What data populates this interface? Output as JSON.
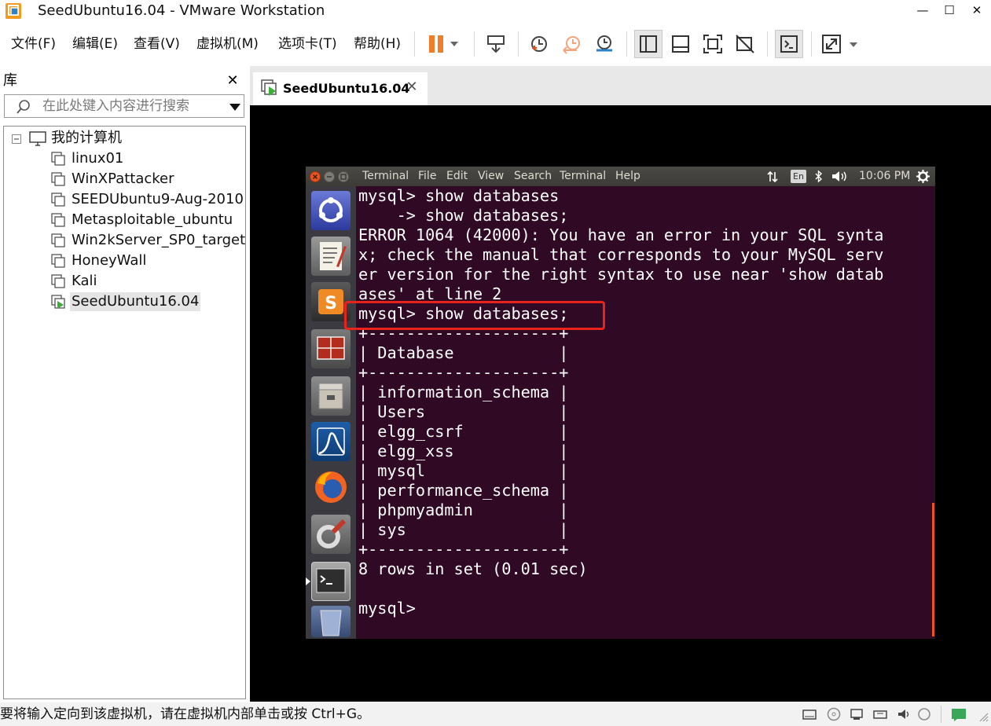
{
  "window": {
    "title": "SeedUbuntu16.04 - VMware Workstation"
  },
  "menu": [
    "文件(F)",
    "编辑(E)",
    "查看(V)",
    "虚拟机(M)",
    "选项卡(T)",
    "帮助(H)"
  ],
  "library": {
    "title": "库",
    "search_placeholder": "在此处键入内容进行搜索",
    "root": "我的计算机",
    "items": [
      "linux01",
      "WinXPattacker",
      "SEEDUbuntu9-Aug-2010",
      "Metasploitable_ubuntu",
      "Win2kServer_SP0_target",
      "HoneyWall",
      "Kali",
      "SeedUbuntu16.04"
    ],
    "selected_index": 7
  },
  "tab": {
    "label": "SeedUbuntu16.04"
  },
  "vm": {
    "menu": [
      "Terminal",
      "File",
      "Edit",
      "View",
      "Search",
      "Terminal",
      "Help"
    ],
    "clock": "10:06 PM",
    "keyboard": "En",
    "terminal_text": "mysql> show databases\n    -> show databases;\nERROR 1064 (42000): You have an error in your SQL synta\nx; check the manual that corresponds to your MySQL serv\ner version for the right syntax to use near 'show datab\nases' at line 2\nmysql> show databases;\n+--------------------+\n| Database           |\n+--------------------+\n| information_schema |\n| Users              |\n| elgg_csrf          |\n| elgg_xss           |\n| mysql              |\n| performance_schema |\n| phpmyadmin         |\n| sys                |\n+--------------------+\n8 rows in set (0.01 sec)\n\nmysql> "
  },
  "status": {
    "text": "要将输入定向到该虚拟机，请在虚拟机内部单击或按 Ctrl+G。"
  },
  "colors": {
    "accent": "#e8231b",
    "terminal_bg": "#300a24",
    "ubuntu_orange": "#e95420",
    "pause_orange": "#f07d2a"
  }
}
